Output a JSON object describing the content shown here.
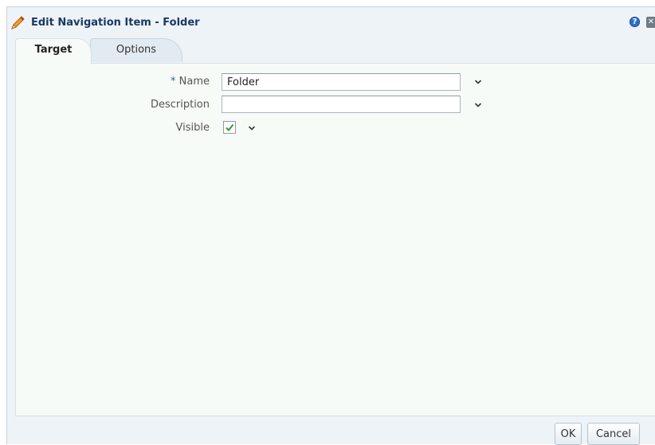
{
  "dialog": {
    "title": "Edit Navigation Item - Folder",
    "help_symbol": "?",
    "close_symbol": "✕"
  },
  "tabs": [
    {
      "label": "Target",
      "selected": true
    },
    {
      "label": "Options",
      "selected": false
    }
  ],
  "form": {
    "name": {
      "required_mark": "*",
      "label": "Name",
      "value": "Folder"
    },
    "description": {
      "label": "Description",
      "value": ""
    },
    "visible": {
      "label": "Visible",
      "checked": true
    }
  },
  "footer": {
    "ok_label": "OK",
    "cancel_label": "Cancel"
  },
  "colors": {
    "title": "#1a3a63",
    "label": "#555555",
    "required": "#2a66b3",
    "check": "#3a9a2a",
    "help": "#2f6fc9"
  }
}
